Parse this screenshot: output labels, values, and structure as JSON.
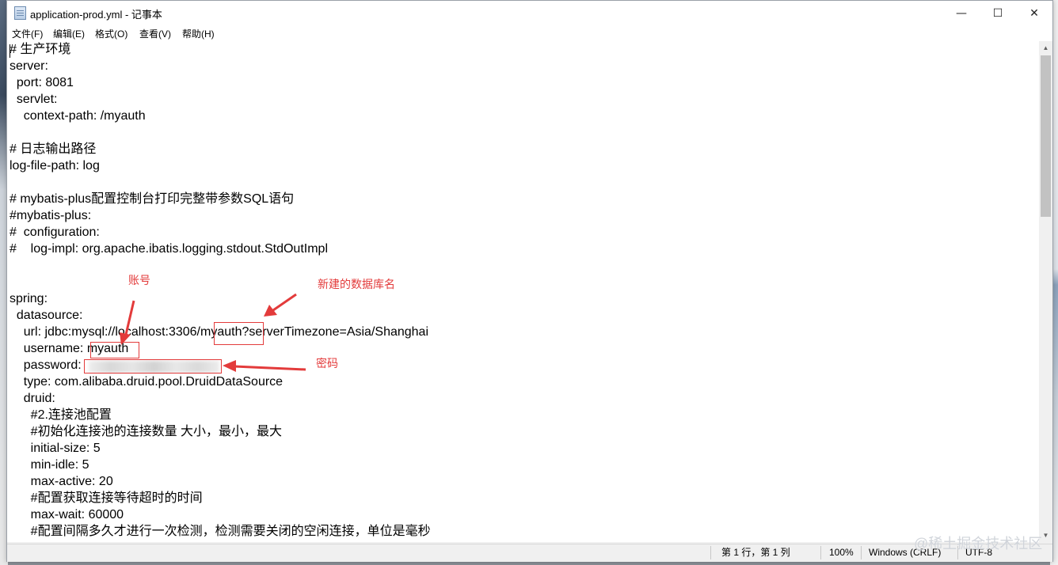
{
  "window": {
    "title": "application-prod.yml - 记事本",
    "controls": {
      "minimize": "—",
      "maximize": "☐",
      "close": "✕"
    }
  },
  "menu": [
    "文件(F)",
    "编辑(E)",
    "格式(O)",
    "查看(V)",
    "帮助(H)"
  ],
  "editor": {
    "lines": [
      "# 生产环境",
      "server:",
      "  port: 8081",
      "  servlet:",
      "    context-path: /myauth",
      "",
      "# 日志输出路径",
      "log-file-path: log",
      "",
      "# mybatis-plus配置控制台打印完整带参数SQL语句",
      "#mybatis-plus:",
      "#  configuration:",
      "#    log-impl: org.apache.ibatis.logging.stdout.StdOutImpl",
      "",
      "",
      "spring:",
      "  datasource:",
      "    url: jdbc:mysql://localhost:3306/myauth?serverTimezone=Asia/Shanghai",
      "    username: myauth",
      "    password:",
      "    type: com.alibaba.druid.pool.DruidDataSource",
      "    druid:",
      "      #2.连接池配置",
      "      #初始化连接池的连接数量 大小，最小，最大",
      "      initial-size: 5",
      "      min-idle: 5",
      "      max-active: 20",
      "      #配置获取连接等待超时的时间",
      "      max-wait: 60000",
      "      #配置间隔多久才进行一次检测，检测需要关闭的空闲连接，单位是毫秒"
    ]
  },
  "status": {
    "position": "第 1 行，第 1 列",
    "zoom": "100%",
    "line_ending": "Windows (CRLF)",
    "encoding": "UTF-8"
  },
  "annotations": {
    "account": "账号",
    "new_db_name": "新建的数据库名",
    "password": "密码",
    "color": "#e33b3b"
  },
  "watermark": "@稀土掘金技术社区"
}
